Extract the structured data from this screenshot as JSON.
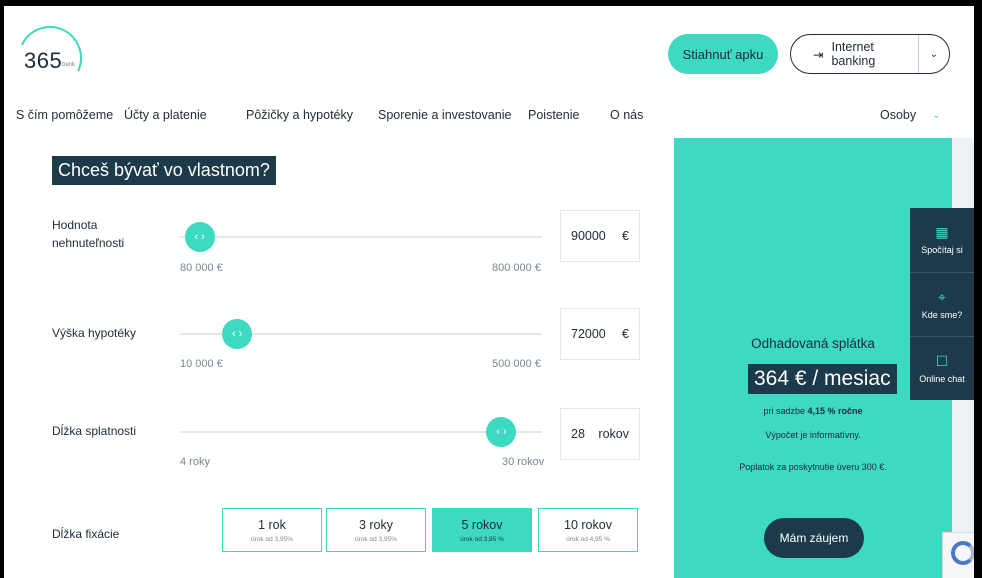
{
  "header": {
    "logo_number": "365",
    "logo_sub": "bank",
    "download_app": "Stiahnuť apku",
    "internet_banking": "Internet banking"
  },
  "nav": {
    "items": [
      "S čím pomôžeme",
      "Účty a platenie",
      "Pôžičky a hypotéky",
      "Sporenie a investovanie",
      "Poistenie",
      "O nás"
    ],
    "segment": "Osoby"
  },
  "calculator": {
    "title": "Chceš bývať vo vlastnom?",
    "property": {
      "label": "Hodnota nehnuteľnosti",
      "min": "80 000 €",
      "max": "800 000 €",
      "value": "90000",
      "unit": "€",
      "fraction": 0.014
    },
    "mortgage": {
      "label": "Výška hypotéky",
      "min": "10 000 €",
      "max": "500 000 €",
      "value": "72000",
      "unit": "€",
      "fraction": 0.127
    },
    "term": {
      "label": "Dĺžka splatnosti",
      "min": "4 roky",
      "max": "30 rokov",
      "value": "28",
      "unit": "rokov",
      "fraction": 0.923
    },
    "fixation": {
      "label": "Dĺžka fixácie",
      "options": [
        {
          "title": "1 rok",
          "rate": "úrok od 3,95%"
        },
        {
          "title": "3 roky",
          "rate": "úrok od 3,95%"
        },
        {
          "title": "5 rokov",
          "rate": "úrok od 3,95 %"
        },
        {
          "title": "10 rokov",
          "rate": "úrok od 4,95 %"
        }
      ],
      "active_index": 2
    }
  },
  "estimate": {
    "title": "Odhadovaná splátka",
    "amount": "364 € / mesiac",
    "rate_prefix": "pri sadzbe",
    "rate_value": "4,15 % ročne",
    "info": "Výpočet je informatívny.",
    "fee": "Poplatok za poskytnutie úveru 300 €.",
    "cta": "Mám záujem"
  },
  "side_widget": {
    "items": [
      {
        "label": "Spočítaj si",
        "icon": "calculator-icon"
      },
      {
        "label": "Kde sme?",
        "icon": "map-pin-icon"
      },
      {
        "label": "Online chat",
        "icon": "chat-icon"
      }
    ]
  },
  "colors": {
    "accent": "#3dd9c1",
    "dark": "#1d3a4a",
    "text": "#1d2b3a"
  }
}
